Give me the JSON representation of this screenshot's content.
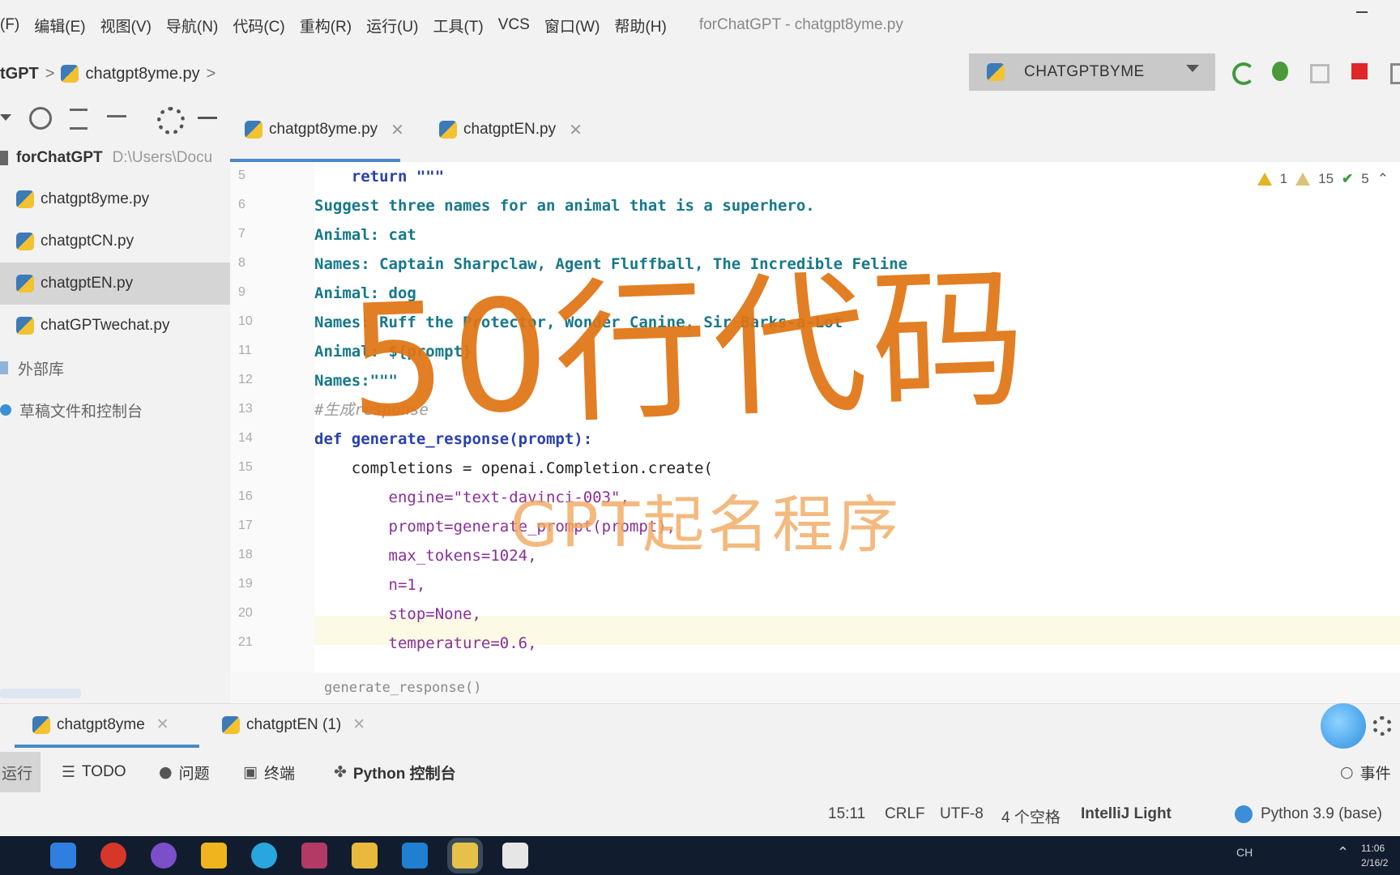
{
  "menu": {
    "items": [
      "(F)",
      "编辑(E)",
      "视图(V)",
      "导航(N)",
      "代码(C)",
      "重构(R)",
      "运行(U)",
      "工具(T)",
      "VCS",
      "窗口(W)",
      "帮助(H)"
    ],
    "window_title": "forChatGPT - chatgpt8yme.py"
  },
  "nav": {
    "root": "tGPT",
    "file": "chatgpt8yme.py",
    "run_config": "CHATGPTBYME"
  },
  "project": {
    "root_name": "forChatGPT",
    "root_path": "D:\\Users\\Docu",
    "files": [
      "chatgpt8yme.py",
      "chatgptCN.py",
      "chatgptEN.py",
      "chatGPTwechat.py"
    ],
    "selected_index": 2,
    "external_libs": "外部库",
    "scratches": "草稿文件和控制台"
  },
  "editor": {
    "tabs": [
      "chatgpt8yme.py",
      "chatgptEN.py"
    ],
    "active_tab": 0,
    "inspections": {
      "warnings": "1",
      "weak_warnings": "15",
      "typos": "5"
    },
    "lines": [
      {
        "n": "5",
        "text": "    return \"\"\"",
        "style": "kw"
      },
      {
        "n": "6",
        "text": "Suggest three names for an animal that is a superhero.",
        "style": "str"
      },
      {
        "n": "7",
        "text": "Animal: cat",
        "style": "str"
      },
      {
        "n": "8",
        "text": "Names: Captain Sharpclaw, Agent Fluffball, The Incredible Feline",
        "style": "str"
      },
      {
        "n": "9",
        "text": "Animal: dog",
        "style": "str"
      },
      {
        "n": "10",
        "text": "Names: Ruff the Protector, Wonder Canine, Sir Barks-a-Lot",
        "style": "str"
      },
      {
        "n": "11",
        "text": "Animal: ${prompt}",
        "style": "str"
      },
      {
        "n": "12",
        "text": "Names:\"\"\"",
        "style": "str"
      },
      {
        "n": "13",
        "text": "#生成response",
        "style": "comment"
      },
      {
        "n": "14",
        "text": "def generate_response(prompt):",
        "style": "kw"
      },
      {
        "n": "15",
        "text": "    completions = openai.Completion.create(",
        "style": "plain"
      },
      {
        "n": "16",
        "text": "        engine=\"text-davinci-003\",",
        "style": "param"
      },
      {
        "n": "17",
        "text": "        prompt=generate_prompt(prompt),",
        "style": "param"
      },
      {
        "n": "18",
        "text": "        max_tokens=1024,",
        "style": "param"
      },
      {
        "n": "19",
        "text": "        n=1,",
        "style": "param"
      },
      {
        "n": "20",
        "text": "        stop=None,",
        "style": "param"
      },
      {
        "n": "21",
        "text": "        temperature=0.6,",
        "style": "param"
      }
    ],
    "current_line": "15",
    "breadcrumb": "generate_response()"
  },
  "overlay": {
    "title": "50行代码",
    "subtitle": "GPT起名程序",
    "color": "#e07514"
  },
  "run_window": {
    "tabs": [
      "chatgpt8yme",
      "chatgptEN (1)"
    ],
    "active_tab": 0
  },
  "tool_strip": {
    "run": "运行",
    "todo": "TODO",
    "problems": "问题",
    "terminal": "终端",
    "python_console": "Python 控制台",
    "events": "事件"
  },
  "status": {
    "position": "15:11",
    "line_sep": "CRLF",
    "encoding": "UTF-8",
    "indent": "4 个空格",
    "theme": "IntelliJ Light",
    "interpreter": "Python 3.9 (base)"
  },
  "taskbar": {
    "tray": "CH",
    "clock_time": "11:06",
    "clock_date": "2/16/2"
  }
}
